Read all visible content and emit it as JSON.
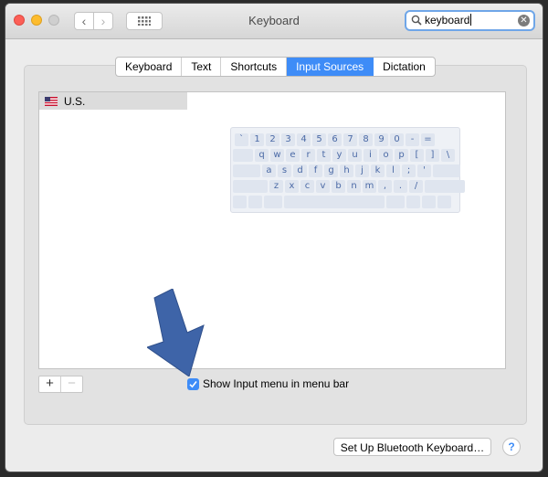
{
  "window": {
    "title": "Keyboard"
  },
  "search": {
    "value": "keyboard"
  },
  "tabs": [
    {
      "label": "Keyboard"
    },
    {
      "label": "Text"
    },
    {
      "label": "Shortcuts"
    },
    {
      "label": "Input Sources",
      "active": true
    },
    {
      "label": "Dictation"
    }
  ],
  "sources": [
    {
      "label": "U.S.",
      "flag": "us-flag-icon"
    }
  ],
  "keyboard_rows": [
    [
      "`",
      "1",
      "2",
      "3",
      "4",
      "5",
      "6",
      "7",
      "8",
      "9",
      "0",
      "-",
      "="
    ],
    [
      "",
      "q",
      "w",
      "e",
      "r",
      "t",
      "y",
      "u",
      "i",
      "o",
      "p",
      "[",
      "]",
      "\\"
    ],
    [
      "",
      "a",
      "s",
      "d",
      "f",
      "g",
      "h",
      "j",
      "k",
      "l",
      ";",
      "'",
      ""
    ],
    [
      "",
      "z",
      "x",
      "c",
      "v",
      "b",
      "n",
      "m",
      ",",
      ".",
      "/",
      ""
    ]
  ],
  "controls": {
    "add": "+",
    "remove": "−"
  },
  "show_input_menu": {
    "label": "Show Input menu in menu bar",
    "checked": true
  },
  "bluetooth_button": "Set Up Bluetooth Keyboard…",
  "help": "?",
  "colors": {
    "accent": "#3e8cf7",
    "arrow": "#3e64a8"
  }
}
